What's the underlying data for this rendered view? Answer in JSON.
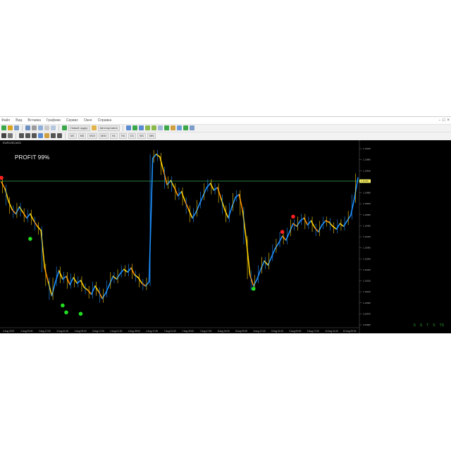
{
  "window": {
    "menu": [
      "Файл",
      "Вид",
      "Вставка",
      "Графики",
      "Сервис",
      "Окно",
      "Справка"
    ],
    "controls": [
      "-",
      "□",
      "×"
    ]
  },
  "toolbar": {
    "algo_trading_label": "Автоторговля",
    "new_order_label": "Новый ордер",
    "timeframes": [
      "M1",
      "M5",
      "M15",
      "M30",
      "H1",
      "H4",
      "D1",
      "W1",
      "MN"
    ]
  },
  "chart": {
    "header": "EURUSD,M15",
    "profit_text": "PROFIT 99%",
    "current_price_tag": "1.10726",
    "y_ticks": [
      "1.10945",
      "1.10880",
      "1.10815",
      "1.10750",
      "1.10685",
      "1.10620",
      "1.10555",
      "1.10490",
      "1.10425",
      "1.10360",
      "1.10295",
      "1.10230",
      "1.10165",
      "1.10100",
      "1.10035",
      "1.09970",
      "1.09905"
    ],
    "x_ticks": [
      "2 Aug 2023",
      "2 Aug 09:00",
      "2 Aug 17:00",
      "3 Aug 01:00",
      "3 Aug 09:00",
      "3 Aug 17:00",
      "4 Aug 01:00",
      "4 Aug 09:00",
      "4 Aug 17:00",
      "7 Aug 01:00",
      "7 Aug 09:00",
      "7 Aug 17:00",
      "8 Aug 01:00",
      "8 Aug 09:00",
      "8 Aug 17:00",
      "9 Aug 01:00",
      "9 Aug 09:00",
      "9 Aug 17:00",
      "10 Aug 01:00",
      "10 Aug 09:00"
    ],
    "corner_icons": [
      "S",
      "S",
      "T",
      "S",
      "TS"
    ],
    "colors": {
      "background": "#000000",
      "level_line": "#2fa84f",
      "price_up": "#1e90ff",
      "price_down": "#ffd000",
      "price_mid": "#ff8c00",
      "buy_signal": "#22dd22",
      "sell_signal": "#ff2020"
    },
    "series_values": [
      1.1072,
      1.1067,
      1.1058,
      1.1052,
      1.1049,
      1.1054,
      1.105,
      1.1046,
      1.1049,
      1.1044,
      1.104,
      1.1037,
      1.101,
      1.1,
      1.099,
      1.1,
      1.1008,
      1.1002,
      1.1004,
      1.0998,
      1.1003,
      1.0999,
      1.1001,
      1.0996,
      1.0994,
      1.0991,
      1.0997,
      1.0993,
      1.0988,
      1.0992,
      1.0998,
      1.1004,
      1.1002,
      1.1006,
      1.1009,
      1.1007,
      1.101,
      1.1005,
      1.1003,
      1.0999,
      1.0997,
      1.1,
      1.1089,
      1.1092,
      1.109,
      1.108,
      1.107,
      1.1073,
      1.1068,
      1.1062,
      1.1065,
      1.1058,
      1.1052,
      1.1046,
      1.105,
      1.1056,
      1.1062,
      1.1068,
      1.1071,
      1.1066,
      1.1068,
      1.106,
      1.1052,
      1.1046,
      1.1054,
      1.1061,
      1.1063,
      1.1051,
      1.103,
      1.1005,
      1.0997,
      1.1002,
      1.1009,
      1.1015,
      1.1012,
      1.1018,
      1.1024,
      1.1028,
      1.1033,
      1.103,
      1.1036,
      1.1042,
      1.104,
      1.1044,
      1.1046,
      1.1041,
      1.1044,
      1.1039,
      1.1036,
      1.1041,
      1.1044,
      1.1043,
      1.104,
      1.1038,
      1.1042,
      1.104,
      1.1044,
      1.1048,
      1.106,
      1.1075
    ],
    "buy_signals": [
      {
        "index": 8,
        "value": 1.1031
      },
      {
        "index": 17,
        "value": 1.0983
      },
      {
        "index": 18,
        "value": 1.0978
      },
      {
        "index": 22,
        "value": 1.0977
      },
      {
        "index": 70,
        "value": 1.0995
      }
    ],
    "sell_signals": [
      {
        "index": 0,
        "value": 1.1075
      },
      {
        "index": 78,
        "value": 1.1036
      },
      {
        "index": 81,
        "value": 1.1047
      }
    ],
    "level_value": 1.10726,
    "y_range": [
      1.0969,
      1.1098
    ]
  }
}
